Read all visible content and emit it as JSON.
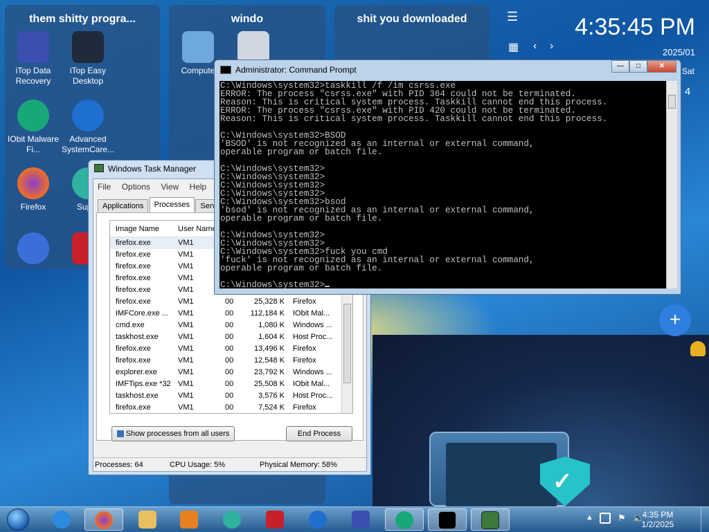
{
  "desktop": {
    "tiles": [
      {
        "title": "them shitty progra..."
      },
      {
        "title": "windo"
      },
      {
        "title": "shit you downloaded"
      }
    ],
    "icons": [
      {
        "label": "iTop Data Recovery"
      },
      {
        "label": "iTop Easy Desktop"
      },
      {
        "label": "IObit Malware Fi..."
      },
      {
        "label": "Advanced SystemCare..."
      },
      {
        "label": "Firefox"
      },
      {
        "label": "Super"
      },
      {
        "label": "Compute"
      }
    ],
    "clock": {
      "time": "4:35:45 PM",
      "date": "2025/01",
      "day": "Sat",
      "day_num": "4"
    },
    "plus_label": "+"
  },
  "task_manager": {
    "title": "Windows Task Manager",
    "menu": [
      "File",
      "Options",
      "View",
      "Help"
    ],
    "tabs": [
      "Applications",
      "Processes",
      "Service"
    ],
    "columns": [
      "Image Name",
      "User Name"
    ],
    "rows": [
      [
        "firefox.exe",
        "VM1",
        "",
        "",
        ""
      ],
      [
        "firefox.exe",
        "VM1",
        "",
        "",
        ""
      ],
      [
        "firefox.exe",
        "VM1",
        "",
        "",
        ""
      ],
      [
        "firefox.exe",
        "VM1",
        "",
        "",
        ""
      ],
      [
        "firefox.exe",
        "VM1",
        "",
        "",
        ""
      ],
      [
        "firefox.exe",
        "VM1",
        "00",
        "25,328 K",
        "Firefox"
      ],
      [
        "IMFCore.exe ...",
        "VM1",
        "00",
        "112,184 K",
        "IObit Mal..."
      ],
      [
        "cmd.exe",
        "VM1",
        "00",
        "1,080 K",
        "Windows ..."
      ],
      [
        "taskhost.exe",
        "VM1",
        "00",
        "1,604 K",
        "Host Proc..."
      ],
      [
        "firefox.exe",
        "VM1",
        "00",
        "13,496 K",
        "Firefox"
      ],
      [
        "firefox.exe",
        "VM1",
        "00",
        "12,548 K",
        "Firefox"
      ],
      [
        "explorer.exe",
        "VM1",
        "00",
        "23,792 K",
        "Windows ..."
      ],
      [
        "IMFTips.exe *32",
        "VM1",
        "00",
        "25,508 K",
        "IObit Mal..."
      ],
      [
        "taskhost.exe",
        "VM1",
        "00",
        "3,576 K",
        "Host Proc..."
      ],
      [
        "firefox.exe",
        "VM1",
        "00",
        "7,524 K",
        "Firefox"
      ]
    ],
    "show_all_label": "Show processes from all users",
    "end_process_label": "End Process",
    "status": {
      "processes": "Processes: 64",
      "cpu": "CPU Usage: 5%",
      "memory": "Physical Memory: 58%"
    }
  },
  "cmd": {
    "title": "Administrator: Command Prompt",
    "output": "C:\\Windows\\system32>taskkill /f /im csrss.exe\nERROR: The process \"csrss.exe\" with PID 364 could not be terminated.\nReason: This is critical system process. Taskkill cannot end this process.\nERROR: The process \"csrss.exe\" with PID 420 could not be terminated.\nReason: This is critical system process. Taskkill cannot end this process.\n\nC:\\Windows\\system32>BSOD\n'BSOD' is not recognized as an internal or external command,\noperable program or batch file.\n\nC:\\Windows\\system32>\nC:\\Windows\\system32>\nC:\\Windows\\system32>\nC:\\Windows\\system32>\nC:\\Windows\\system32>bsod\n'bsod' is not recognized as an internal or external command,\noperable program or batch file.\n\nC:\\Windows\\system32>\nC:\\Windows\\system32>\nC:\\Windows\\system32>fuck you cmd\n'fuck' is not recognized as an internal or external command,\noperable program or batch file.\n\n",
    "prompt": "C:\\Windows\\system32>"
  },
  "taskbar": {
    "time": "4:35 PM",
    "date": "1/2/2025"
  },
  "colors": {
    "accent": "#2f7fe0",
    "taskbar": "#3a7ab8",
    "console_bg": "#000000"
  }
}
